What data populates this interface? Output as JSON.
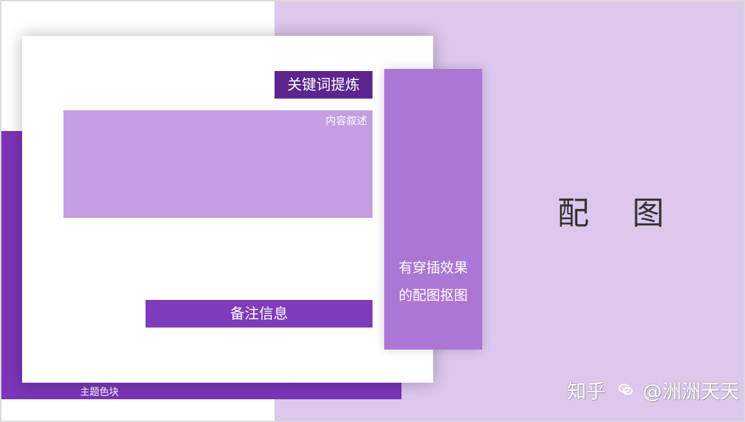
{
  "colors": {
    "right_panel": "#dcc7ed",
    "theme_block": "#7b35b8",
    "keyword_box": "#5d2590",
    "content_box": "#c59fe2",
    "note_box": "#7e3bbb",
    "vertical_box": "#ac76d6"
  },
  "slide": {
    "keyword_label": "关键词提炼",
    "content_label": "内容叙述",
    "note_label": "备注信息",
    "vertical_lines": [
      "有穿插效果",
      "的配图抠图"
    ],
    "image_label": "配 图",
    "theme_label": "主题色块"
  },
  "watermark": {
    "prefix": "知乎",
    "handle": "@洲洲天天",
    "icon": "wechat-icon"
  }
}
